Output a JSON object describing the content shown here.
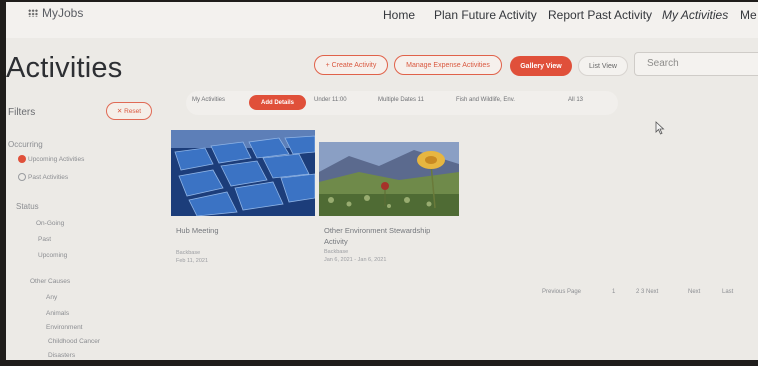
{
  "header": {
    "app_name": "MyJobs",
    "nav": [
      "Home",
      "Plan Future Activity",
      "Report Past Activity",
      "My Activities",
      "Me"
    ]
  },
  "page": {
    "title": "Activities"
  },
  "toolbar": {
    "create_label": "+ Create Activity",
    "manage_label": "Manage Expense Activities",
    "gallery_label": "Gallery View",
    "list_label": "List View",
    "search_placeholder": "Search"
  },
  "filters": {
    "label": "Filters",
    "reset_label": "✕ Reset",
    "occurring_label": "Occurring",
    "occurring_options": [
      "Upcoming Activities",
      "Past Activities"
    ],
    "status_label": "Status",
    "status_options": [
      "On-Going",
      "Past",
      "Upcoming"
    ],
    "other_label": "Other Causes",
    "other_options": [
      "Any",
      "Animals",
      "Environment",
      "Childhood Cancer",
      "Disasters"
    ]
  },
  "chips": [
    "My Activities",
    "Add Details",
    "Under 11:00",
    "Multiple Dates 11",
    "Fish and Wildlife, Env.",
    "All 13"
  ],
  "cards": [
    {
      "title": "Hub Meeting",
      "subtitle": "Backbase",
      "dates": "Feb 11, 2021"
    },
    {
      "title_lines": [
        "Other Environment Stewardship",
        "Activity"
      ],
      "subtitle": "Backbase",
      "dates": "Jan 6, 2021 - Jan 6, 2021"
    }
  ],
  "pagination": [
    "Previous Page",
    "1",
    "2 3 Next",
    "Next",
    "Last"
  ],
  "colors": {
    "accent": "#e0503a",
    "background": "#eceae6"
  }
}
